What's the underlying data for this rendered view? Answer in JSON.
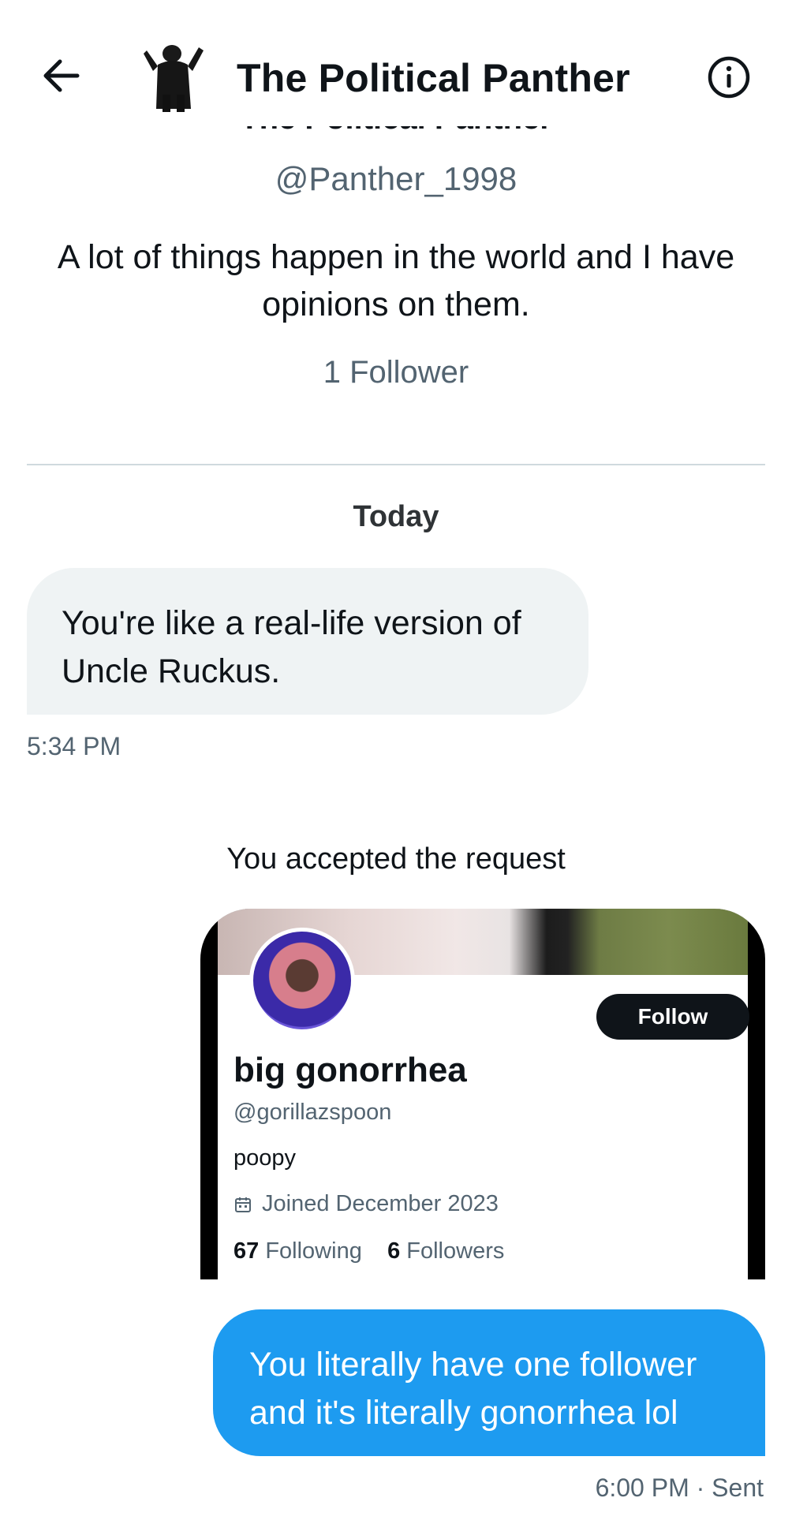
{
  "header": {
    "title": "The Political Panther",
    "back_icon": "arrow-left-icon",
    "info_icon": "info-circle-icon"
  },
  "profile": {
    "name": "The Political Panther",
    "handle": "@Panther_1998",
    "bio": "A lot of things happen in the world and I have opinions on them.",
    "followers": "1 Follower"
  },
  "conversation": {
    "date_separator": "Today",
    "messages": [
      {
        "text": "You're like a real-life version of Uncle Ruckus.",
        "time": "5:34 PM"
      }
    ],
    "system_message": "You accepted the request",
    "shared_card": {
      "follow_label": "Follow",
      "name": "big gonorrhea",
      "handle": "@gorillazspoon",
      "bio": "poopy",
      "joined": "Joined December 2023",
      "following_count": "67",
      "following_label": "Following",
      "followers_count": "6",
      "followers_label": "Followers"
    },
    "sent_message": {
      "text": "You literally have one follower and it's literally gonorrhea lol",
      "status": "6:00 PM · Sent"
    }
  },
  "colors": {
    "accent": "#1d9bf0",
    "incoming_bubble": "#eff3f4",
    "secondary_text": "#536471"
  }
}
